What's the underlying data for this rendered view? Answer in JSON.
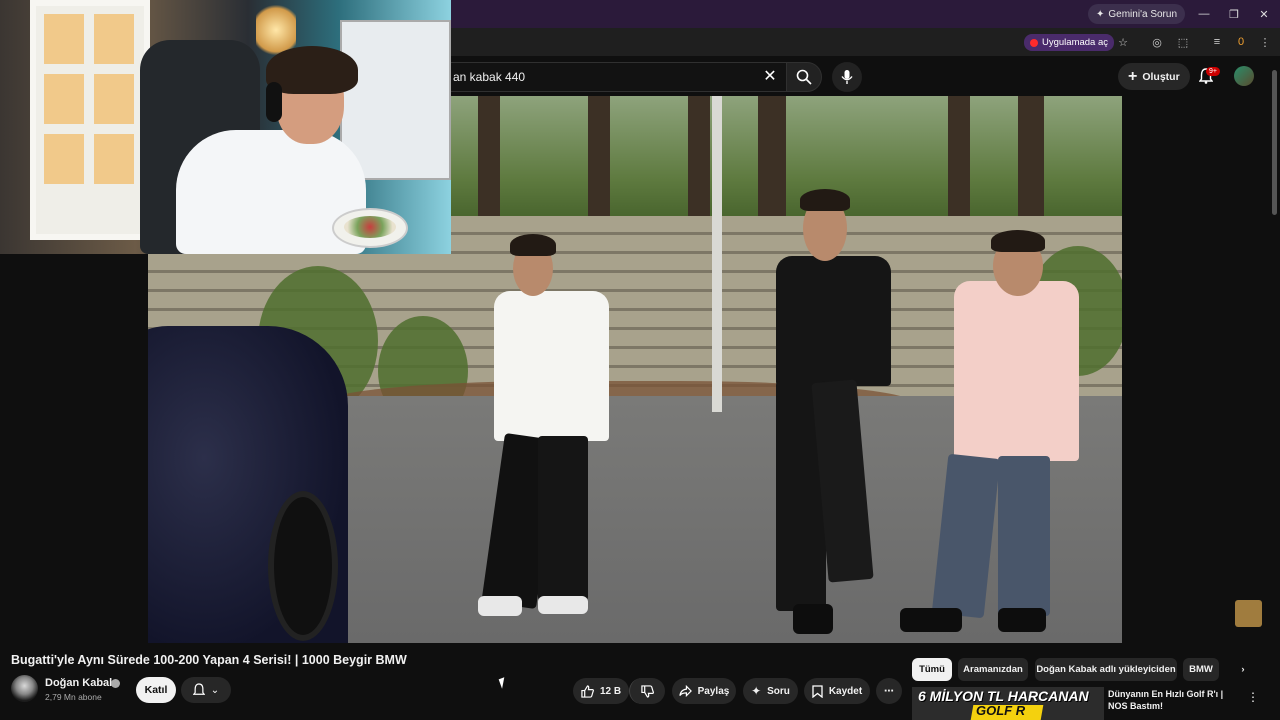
{
  "browser": {
    "gemini_label": "Gemini'a Sorun",
    "open_app_label": "Uygulamada aç",
    "extension_count": "0"
  },
  "header": {
    "search_value": "an kabak 440",
    "create_label": "Oluştur",
    "notification_badge": "9+"
  },
  "video": {
    "title": "Bugatti'yle Aynı Sürede 100-200 Yapan 4 Serisi! | 1000 Beygir BMW",
    "channel_name": "Doğan Kabak",
    "subscribers": "2,79 Mn abone",
    "join_label": "Katıl",
    "like_count": "12 B",
    "share_label": "Paylaş",
    "ask_label": "Soru",
    "save_label": "Kaydet"
  },
  "chips": [
    {
      "label": "Tümü",
      "active": true
    },
    {
      "label": "Aramanızdan",
      "active": false
    },
    {
      "label": "Doğan Kabak adlı yükleyiciden",
      "active": false
    },
    {
      "label": "BMW",
      "active": false
    }
  ],
  "related": {
    "thumb_text": "6 MİLYON TL HARCANAN",
    "thumb_subtext": "GOLF R",
    "title": "Dünyanın En Hızlı Golf R'ı | NOS Bastım!"
  },
  "colors": {
    "background": "#0f0f0f",
    "chip_active": "#f1f1f1",
    "browser_frame": "#2b1a3a",
    "open_app": "#4a2b6b"
  }
}
